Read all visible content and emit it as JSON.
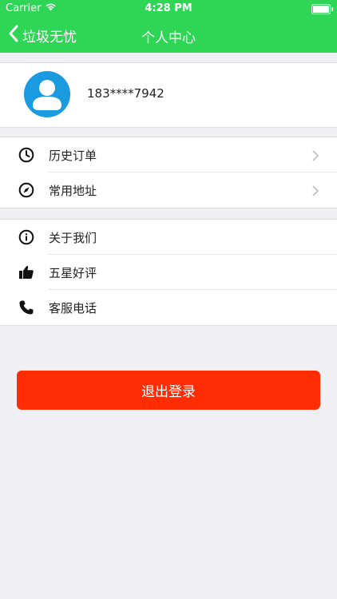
{
  "status_bar": {
    "carrier": "Carrier",
    "time": "4:28 PM",
    "wifi_icon": "wifi-icon",
    "battery_icon": "battery-icon"
  },
  "nav": {
    "back_label": "垃圾无忧",
    "back_icon": "chevron-left-icon",
    "title": "个人中心"
  },
  "profile": {
    "avatar_icon": "user-avatar-icon",
    "phone": "183****7942"
  },
  "menu_group_1": [
    {
      "label": "历史订单",
      "icon": "clock-icon",
      "chevron": true
    },
    {
      "label": "常用地址",
      "icon": "compass-icon",
      "chevron": true
    }
  ],
  "menu_group_2": [
    {
      "label": "关于我们",
      "icon": "info-icon"
    },
    {
      "label": "五星好评",
      "icon": "thumbs-up-icon"
    },
    {
      "label": "客服电话",
      "icon": "phone-icon"
    }
  ],
  "logout_label": "退出登录",
  "colors": {
    "nav_green": "#2fd655",
    "logout_red": "#ff2c04",
    "avatar_blue": "#1a9be0",
    "background": "#efeff4"
  }
}
